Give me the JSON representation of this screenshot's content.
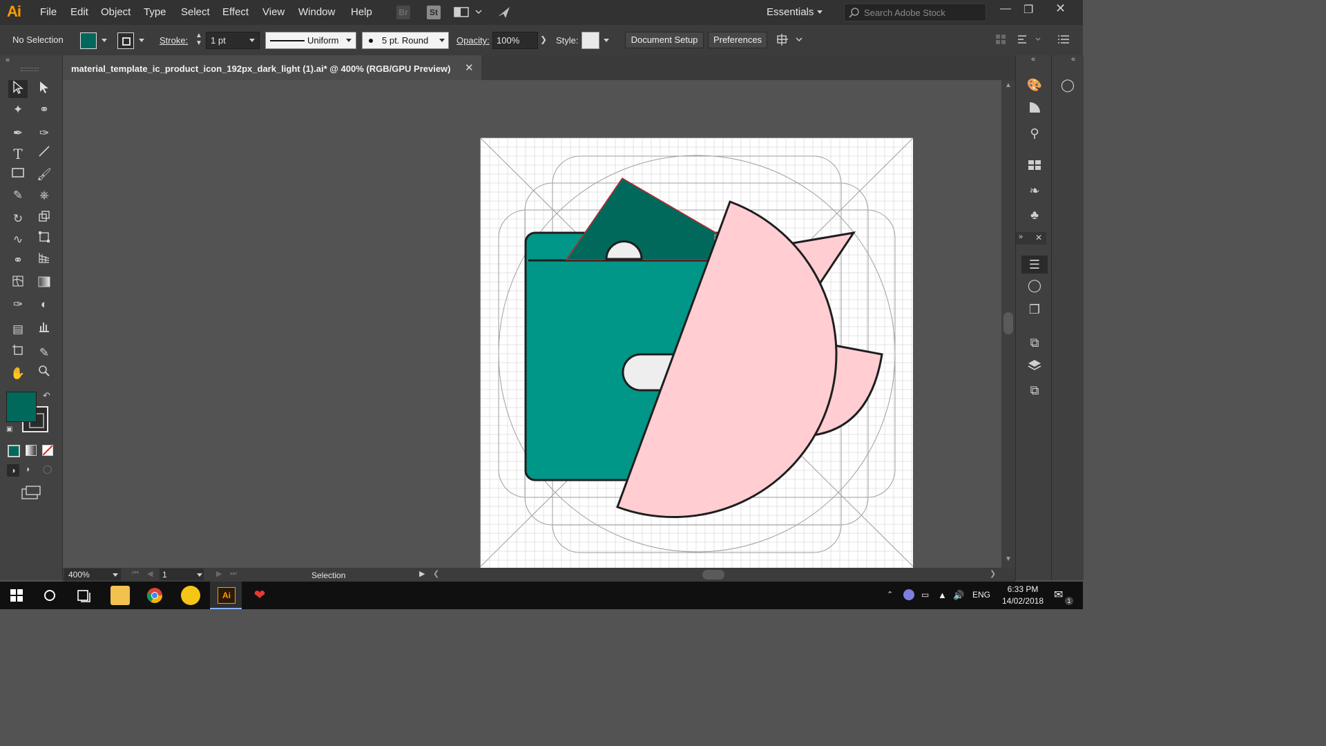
{
  "app": {
    "logo": "Ai",
    "menu": [
      "File",
      "Edit",
      "Object",
      "Type",
      "Select",
      "Effect",
      "View",
      "Window",
      "Help"
    ],
    "bridge_label": "Br",
    "stock_label": "St",
    "workspace": "Essentials",
    "search_placeholder": "Search Adobe Stock"
  },
  "control_bar": {
    "selection_state": "No Selection",
    "fill_color": "#00695c",
    "stroke_label": "Stroke:",
    "stroke_weight": "1 pt",
    "stroke_profile": "Uniform",
    "brush": "5 pt. Round",
    "opacity_label": "Opacity:",
    "opacity_value": "100%",
    "style_label": "Style:",
    "document_setup": "Document Setup",
    "preferences": "Preferences"
  },
  "document": {
    "tab_title": "material_template_ic_product_icon_192px_dark_light (1).ai* @ 400% (RGB/GPU Preview)",
    "zoom": "400%",
    "artboard_number": "1",
    "status_tool": "Selection"
  },
  "artwork_colors": {
    "wallet": "#009688",
    "card": "#00695c",
    "pink": "#ffcdd2",
    "outline": "#1e1e1e",
    "hole": "#eeeeee",
    "grid": "#cfcfcf",
    "keyline": "#9e9e9e"
  },
  "tools": {
    "fill_swatch": "#00695c",
    "stroke_swatch": "#000000"
  },
  "taskbar": {
    "apps": [
      "start-icon",
      "cortana-icon",
      "task-view-icon",
      "file-explorer-icon",
      "chrome-icon",
      "pencil-app-icon",
      "illustrator-icon",
      "garena-icon"
    ],
    "illustrator_label": "Ai",
    "language": "ENG",
    "time": "6:33 PM",
    "date": "14/02/2018",
    "notification_count": "1"
  }
}
